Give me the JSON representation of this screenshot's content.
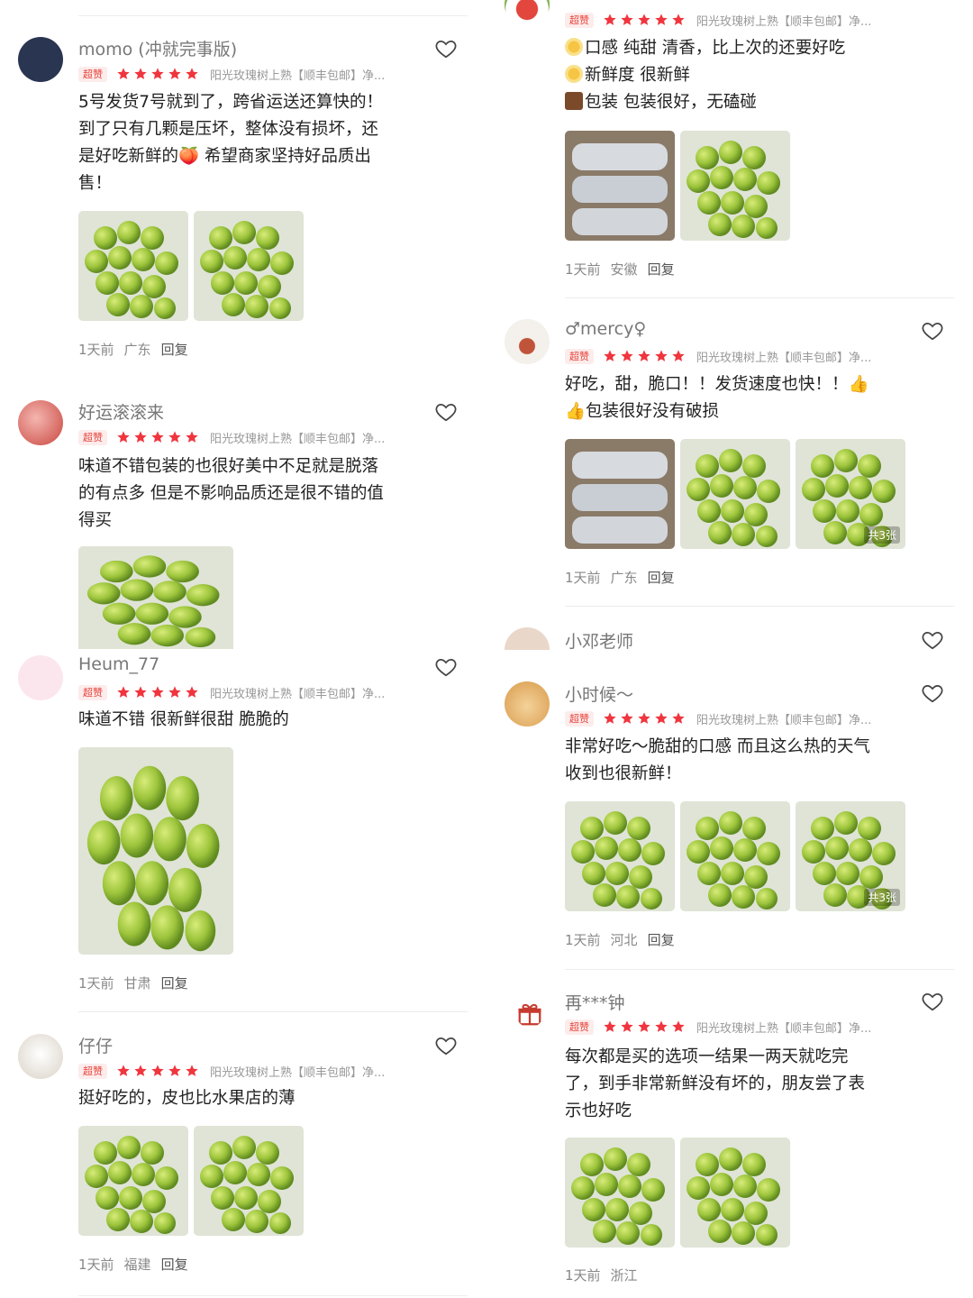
{
  "colors": {
    "accent": "#e8433a",
    "star": "#f0353e",
    "grape": "#9cc43b",
    "text": "#222222",
    "muted": "#888888"
  },
  "sku_text": "阳光玫瑰树上熟【顺丰包邮】净...",
  "badge_text": "超赞",
  "reply_label": "回复",
  "left": [
    {
      "user": "momo (冲就完事版)",
      "lines": [
        "5号发货7号就到了，跨省运送还算快的！",
        "到了只有几颗是压坏，整体没有损坏，还",
        "是好吃新鲜的🍑 希望商家坚持好品质出",
        "售！"
      ],
      "time": "1天前",
      "region": "广东",
      "photos": 2
    },
    {
      "user": "好运滚滚来",
      "lines": [
        "味道不错包装的也很好美中不足就是脱落",
        "的有点多 但是不影响品质还是很不错的值",
        "得买"
      ],
      "time": "",
      "region": "",
      "photos": 1
    },
    {
      "user": "Heum_77",
      "lines": [
        "味道不错 很新鲜很甜 脆脆的"
      ],
      "time": "1天前",
      "region": "甘肃",
      "photos": 1
    },
    {
      "user": "仔仔",
      "lines": [
        "挺好吃的，皮也比水果店的薄"
      ],
      "time": "1天前",
      "region": "福建",
      "photos": 2
    }
  ],
  "right": [
    {
      "user": "",
      "lines": [
        "口感 纯甜 清香，比上次的还要好吃",
        "新鲜度 很新鲜",
        "包装 包装很好，无磕碰"
      ],
      "time": "1天前",
      "region": "安徽",
      "photos": 2
    },
    {
      "user": "♂mercy♀",
      "lines": [
        "好吃，甜，脆口！！发货速度也快！！👍",
        "👍包装很好没有破损"
      ],
      "time": "1天前",
      "region": "广东",
      "photos": 3,
      "count": "共3张"
    },
    {
      "user": "小邓老师",
      "lines": [],
      "time": "",
      "region": "",
      "photos": 0
    },
    {
      "user": "小时候～",
      "lines": [
        "非常好吃～脆甜的口感 而且这么热的天气",
        "收到也很新鲜！"
      ],
      "time": "1天前",
      "region": "河北",
      "photos": 3,
      "count": "共3张"
    },
    {
      "user": "再***钟",
      "lines": [
        "每次都是买的选项一结果一两天就吃完",
        "了，到手非常新鲜没有坏的，朋友尝了表",
        "示也好吃"
      ],
      "time": "1天前",
      "region": "浙江",
      "photos": 2
    }
  ]
}
